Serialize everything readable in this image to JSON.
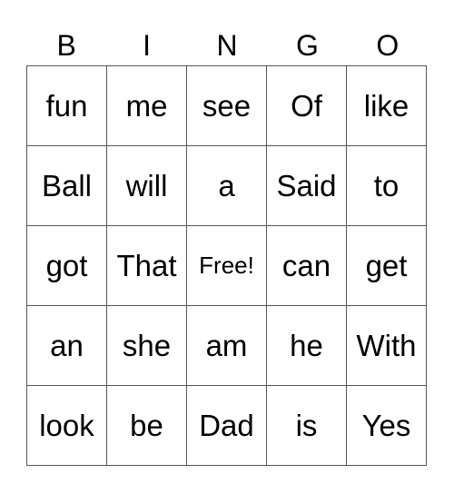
{
  "header": [
    "B",
    "I",
    "N",
    "G",
    "O"
  ],
  "rows": [
    [
      "fun",
      "me",
      "see",
      "Of",
      "like"
    ],
    [
      "Ball",
      "will",
      "a",
      "Said",
      "to"
    ],
    [
      "got",
      "That",
      "Free!",
      "can",
      "get"
    ],
    [
      "an",
      "she",
      "am",
      "he",
      "With"
    ],
    [
      "look",
      "be",
      "Dad",
      "is",
      "Yes"
    ]
  ]
}
